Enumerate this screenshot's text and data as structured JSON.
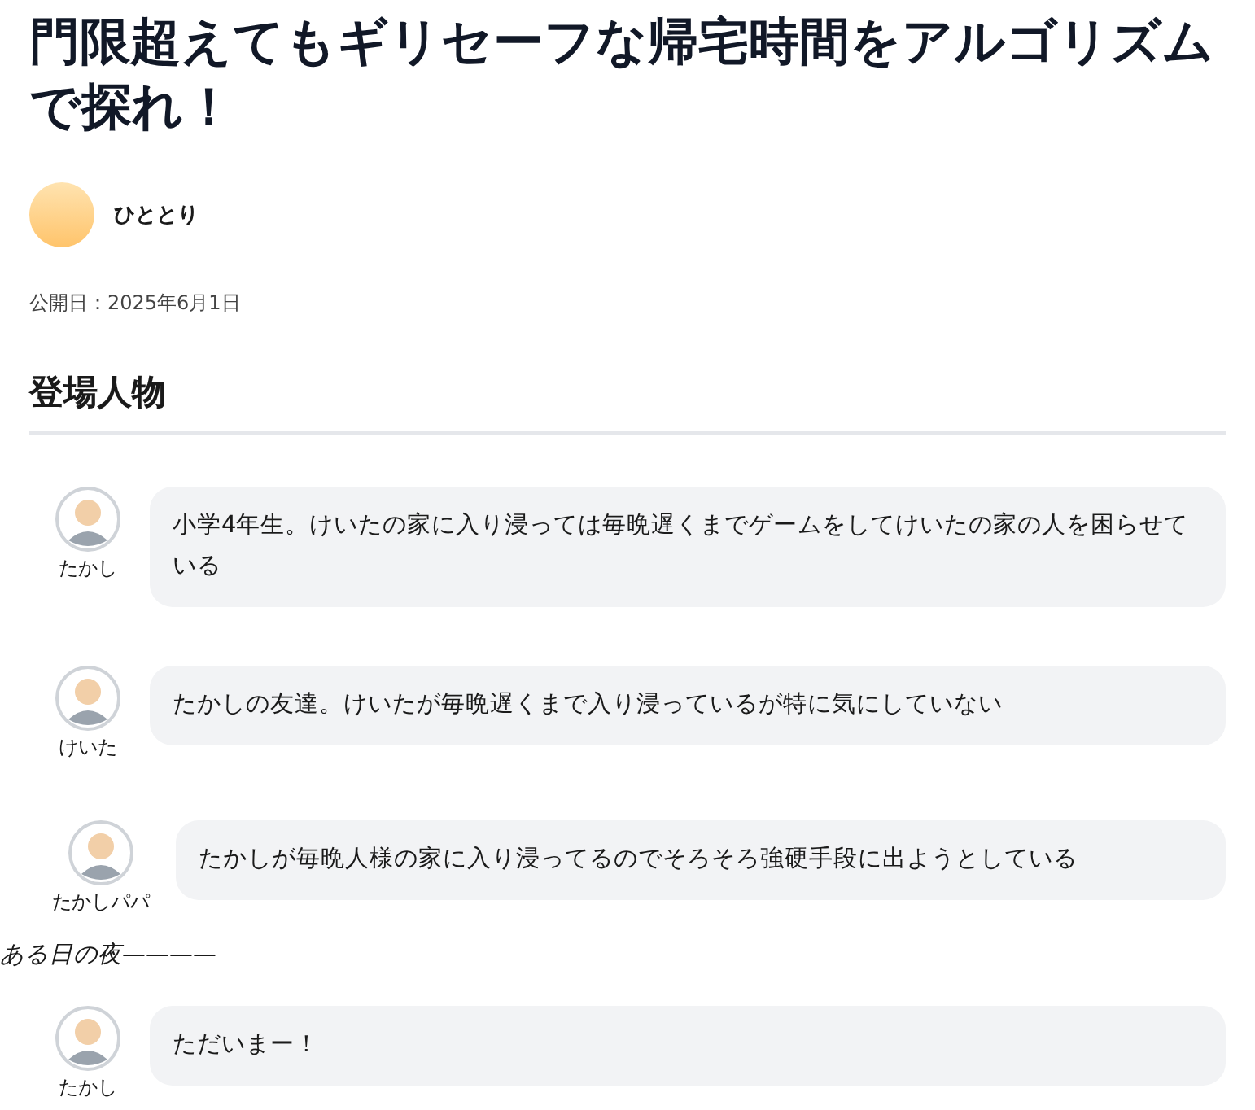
{
  "article": {
    "title": "門限超えてもギリセーフな帰宅時間をアルゴリズムで探れ！",
    "author": "ひととり",
    "published": "公開日：2025年6月1日"
  },
  "section": {
    "heading": "登場人物"
  },
  "items": [
    {
      "kind": "chat",
      "speaker": "たかし",
      "text": "小学4年生。けいたの家に入り浸っては毎晩遅くまでゲームをしてけいたの家の人を困らせている"
    },
    {
      "kind": "chat",
      "speaker": "けいた",
      "text": "たかしの友達。けいたが毎晩遅くまで入り浸っているが特に気にしていない"
    },
    {
      "kind": "chat",
      "speaker": "たかしパパ",
      "text": "たかしが毎晩人様の家に入り浸ってるのでそろそろ強硬手段に出ようとしている"
    },
    {
      "kind": "narration",
      "text": "ある日の夜————"
    },
    {
      "kind": "chat",
      "speaker": "たかし",
      "text": "ただいまー！"
    }
  ]
}
